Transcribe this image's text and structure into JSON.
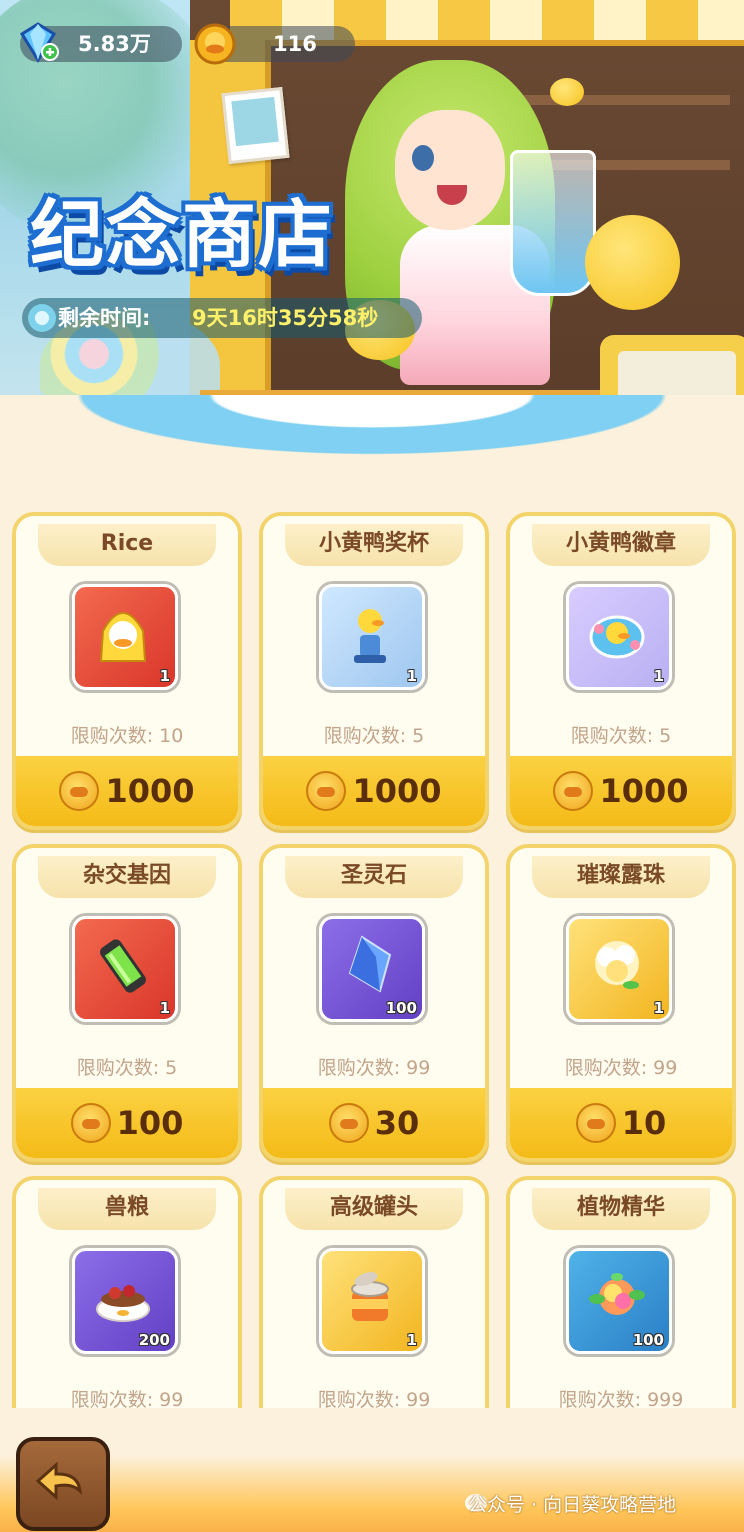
{
  "currency": {
    "gems": "5.83万",
    "coins": "116"
  },
  "banner": {
    "title": "纪念商店",
    "timer_label": "剩余时间:",
    "timer_value": "9天16时35分58秒"
  },
  "colors": {
    "price_bar": "#f4bb17",
    "card_border": "#f3d46a",
    "title_stroke": "#1d6ed0",
    "timer_value": "#fff16a"
  },
  "items": [
    {
      "name": "Rice",
      "qty": "1",
      "limit": "限购次数: 10",
      "price": "1000",
      "rarity": "red",
      "icon": "duck-raincoat-icon"
    },
    {
      "name": "小黄鸭奖杯",
      "qty": "1",
      "limit": "限购次数: 5",
      "price": "1000",
      "rarity": "blue",
      "icon": "duck-trophy-icon"
    },
    {
      "name": "小黄鸭徽章",
      "qty": "1",
      "limit": "限购次数: 5",
      "price": "1000",
      "rarity": "blue",
      "icon": "duck-badge-icon"
    },
    {
      "name": "杂交基因",
      "qty": "1",
      "limit": "限购次数: 5",
      "price": "100",
      "rarity": "red",
      "icon": "gene-tube-icon"
    },
    {
      "name": "圣灵石",
      "qty": "100",
      "limit": "限购次数: 99",
      "price": "30",
      "rarity": "purple",
      "icon": "crystal-icon"
    },
    {
      "name": "璀璨露珠",
      "qty": "1",
      "limit": "限购次数: 99",
      "price": "10",
      "rarity": "gold",
      "icon": "dewdrop-flower-icon"
    },
    {
      "name": "兽粮",
      "qty": "200",
      "limit": "限购次数: 99",
      "price": "",
      "rarity": "purple",
      "icon": "pet-food-bowl-icon"
    },
    {
      "name": "高级罐头",
      "qty": "1",
      "limit": "限购次数: 99",
      "price": "",
      "rarity": "gold",
      "icon": "canned-food-icon"
    },
    {
      "name": "植物精华",
      "qty": "100",
      "limit": "限购次数: 999",
      "price": "",
      "rarity": "teal",
      "icon": "plant-essence-icon"
    }
  ],
  "footer": {
    "watermark": "公众号 · 向日葵攻略营地"
  }
}
